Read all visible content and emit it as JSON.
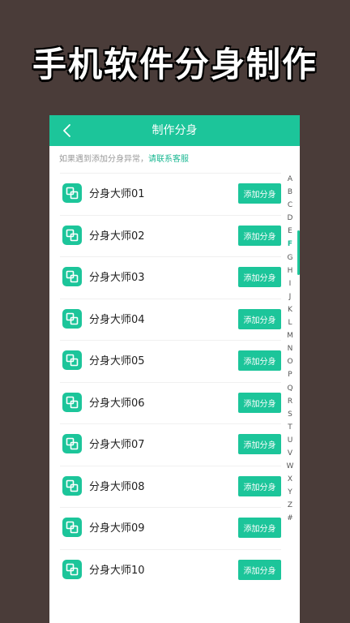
{
  "promo": {
    "title": "手机软件分身制作"
  },
  "appbar": {
    "title": "制作分身",
    "back_icon": "chevron-left-icon"
  },
  "notice": {
    "text": "如果遇到添加分身异常，",
    "link": "请联系客服"
  },
  "button_label": "添加分身",
  "items": [
    {
      "name": "分身大师01"
    },
    {
      "name": "分身大师02"
    },
    {
      "name": "分身大师03"
    },
    {
      "name": "分身大师04"
    },
    {
      "name": "分身大师05"
    },
    {
      "name": "分身大师06"
    },
    {
      "name": "分身大师07"
    },
    {
      "name": "分身大师08"
    },
    {
      "name": "分身大师09"
    },
    {
      "name": "分身大师10"
    }
  ],
  "index_letters": [
    "A",
    "B",
    "C",
    "D",
    "E",
    "F",
    "G",
    "H",
    "I",
    "J",
    "K",
    "L",
    "M",
    "N",
    "O",
    "P",
    "Q",
    "R",
    "S",
    "T",
    "U",
    "V",
    "W",
    "X",
    "Y",
    "Z",
    "#"
  ],
  "active_letter": "F",
  "colors": {
    "accent": "#1cc59a",
    "background": "#4a3c39"
  }
}
